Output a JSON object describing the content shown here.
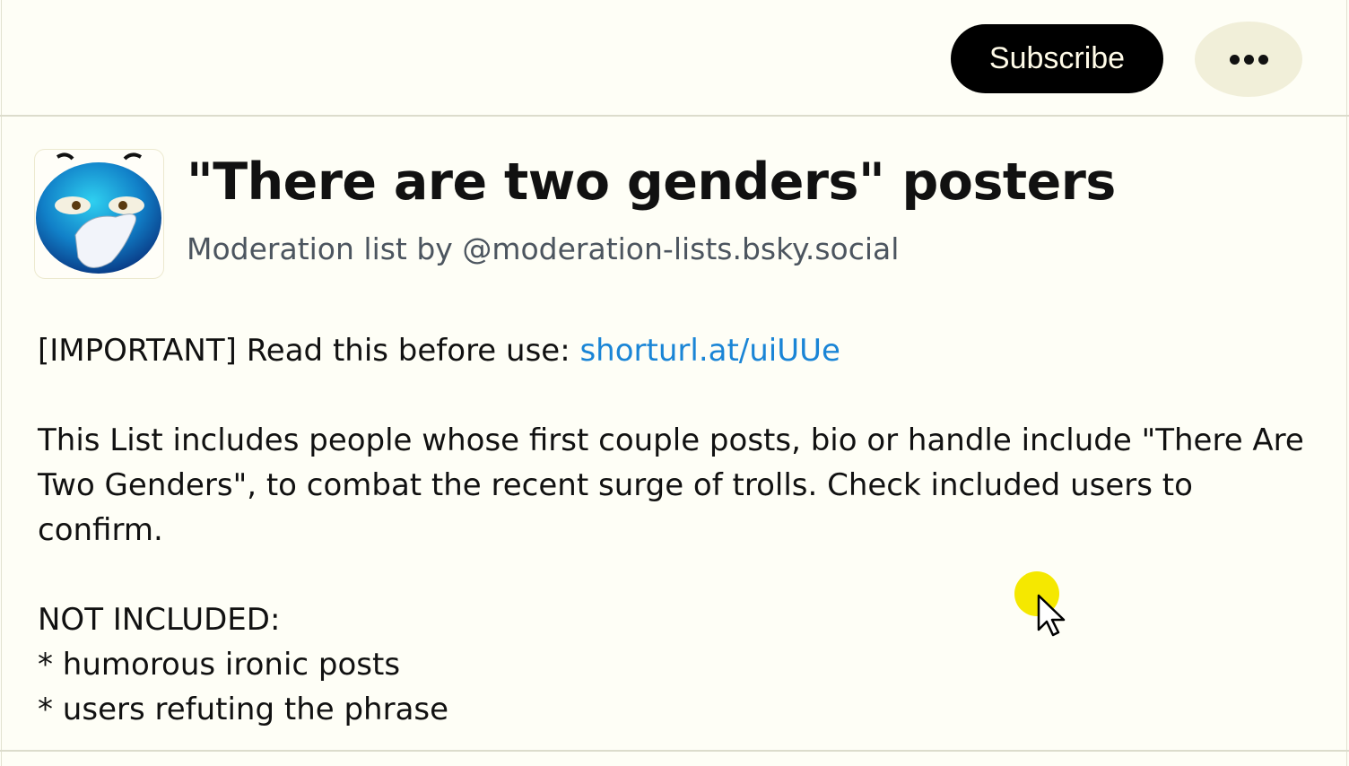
{
  "header": {
    "subscribe_label": "Subscribe",
    "more_icon": "ellipsis-icon"
  },
  "list": {
    "avatar_icon": "blue-emoji-face-palm-avatar",
    "title": "\"There are two genders\" posters",
    "subtitle": "Moderation list by @moderation-lists.bsky.social",
    "description": {
      "important_prefix": "[IMPORTANT] Read this before use: ",
      "link_text": "shorturl.at/uiUUe",
      "paragraph": "This List includes people whose first couple posts, bio or handle include \"There Are Two Genders\", to combat the recent surge of trolls. Check included users to confirm.",
      "not_included_heading": "NOT INCLUDED:",
      "not_included_items": [
        "* humorous ironic posts",
        "* users refuting the phrase"
      ]
    }
  },
  "colors": {
    "link": "#1a85d6",
    "background": "#fefef6",
    "subscribe_bg": "#000000",
    "more_bg": "#f1efd9",
    "cursor_highlight": "#f5e800"
  }
}
